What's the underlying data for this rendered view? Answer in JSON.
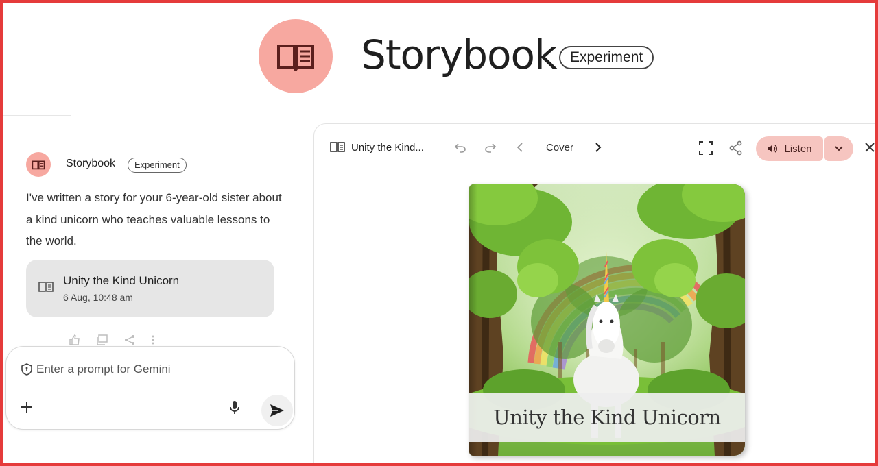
{
  "header": {
    "title": "Storybook",
    "badge": "Experiment",
    "logo_icon": "book-open-icon",
    "logo_color": "#f7a8a0"
  },
  "chat": {
    "sender": "Storybook",
    "sender_badge": "Experiment",
    "message": "I've written a story for your 6-year-old sister about a kind unicorn who teaches valuable lessons to the world.",
    "story_card": {
      "title": "Unity the Kind Unicorn",
      "date": "6 Aug, 10:48 am"
    },
    "feedback_icons": [
      "thumbs-up-icon",
      "copy-icon",
      "share-icon",
      "more-icon"
    ]
  },
  "prompt": {
    "placeholder": "Enter a prompt for Gemini",
    "value": ""
  },
  "viewer": {
    "title": "Unity the Kind...",
    "page": "Cover",
    "listen_label": "Listen",
    "accent": "#f6c5c0"
  },
  "cover": {
    "caption": "Unity the Kind Unicorn"
  }
}
